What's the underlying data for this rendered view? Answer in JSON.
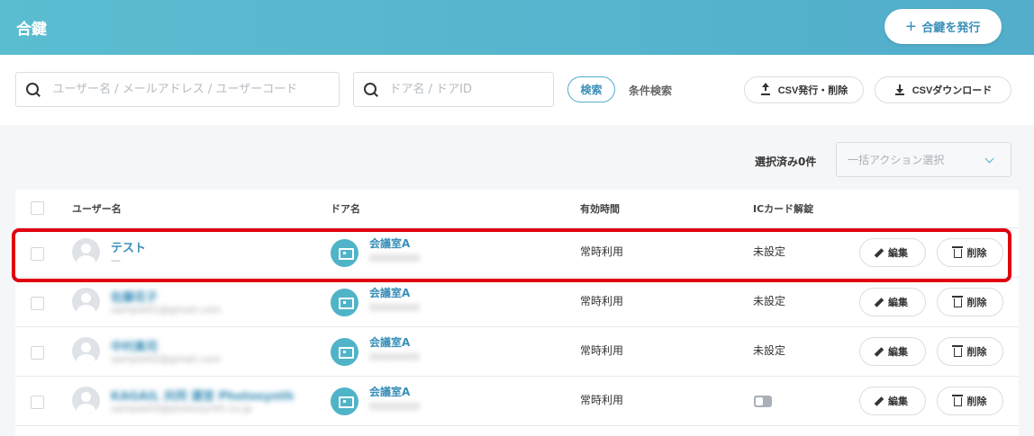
{
  "header": {
    "title": "合鍵",
    "issue_button": "合鍵を発行"
  },
  "search": {
    "user_placeholder": "ユーザー名 / メールアドレス / ユーザーコード",
    "door_placeholder": "ドア名 / ドアID",
    "search_button": "検索",
    "condition_link": "条件検索",
    "csv_issue_button": "CSV発行・削除",
    "csv_download_button": "CSVダウンロード"
  },
  "selection": {
    "count_label": "選択済み0件",
    "bulk_action_placeholder": "一括アクション選択"
  },
  "table": {
    "columns": [
      "ユーザー名",
      "ドア名",
      "有効時間",
      "ICカード解錠"
    ],
    "rows": [
      {
        "user": "テスト",
        "user_sub": "—",
        "door": "会議室A",
        "door_sub": "00000000",
        "validity": "常時利用",
        "ic": "未設定",
        "ic_toggle": false
      },
      {
        "user": "佐藤花子",
        "user_sub": "sample01@gmail.com",
        "door": "会議室A",
        "door_sub": "00000000",
        "validity": "常時利用",
        "ic": "未設定",
        "ic_toggle": false
      },
      {
        "user": "中村真司",
        "user_sub": "sample02@gmail.com",
        "door": "会議室A",
        "door_sub": "00000000",
        "validity": "常時利用",
        "ic": "未設定",
        "ic_toggle": false
      },
      {
        "user": "KAGAIL 共同 運営 Photosynth",
        "user_sub": "sample03@photosynth.co.jp",
        "door": "会議室A",
        "door_sub": "00000000",
        "validity": "常時利用",
        "ic": "",
        "ic_toggle": true
      }
    ],
    "edit_label": "編集",
    "delete_label": "削除"
  },
  "colors": {
    "accent": "#52aecb",
    "link": "#3a8fb7",
    "highlight": "#e1000f"
  }
}
